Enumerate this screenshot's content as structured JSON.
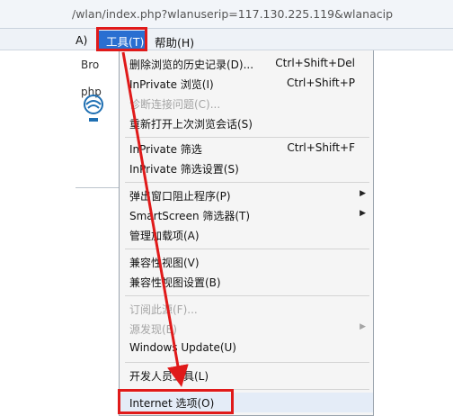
{
  "address_bar": {
    "url": "/wlan/index.php?wlanuserip=117.130.225.119&wlanacip"
  },
  "menubar": {
    "cut_item": "A)",
    "tools": "工具(T)",
    "help": "帮助(H)"
  },
  "page_fragments": [
    "Bro",
    "php"
  ],
  "menu_items": [
    {
      "label": "删除浏览的历史记录(D)...",
      "shortcut": "Ctrl+Shift+Del"
    },
    {
      "label": "InPrivate 浏览(I)",
      "shortcut": "Ctrl+Shift+P"
    },
    {
      "label": "诊断连接问题(C)..."
    },
    {
      "label": "重新打开上次浏览会话(S)"
    },
    {
      "label": "InPrivate 筛选",
      "shortcut": "Ctrl+Shift+F"
    },
    {
      "label": "InPrivate 筛选设置(S)"
    },
    {
      "label": "弹出窗口阻止程序(P)"
    },
    {
      "label": "SmartScreen 筛选器(T)"
    },
    {
      "label": "管理加载项(A)"
    },
    {
      "label": "兼容性视图(V)"
    },
    {
      "label": "兼容性视图设置(B)"
    },
    {
      "label": "订阅此源(F)..."
    },
    {
      "label": "源发现(E)"
    },
    {
      "label": "Windows Update(U)"
    },
    {
      "label": "开发人员工具(L)"
    },
    {
      "label": "Internet 选项(O)"
    }
  ],
  "colors": {
    "highlight": "#2a6fd1",
    "annotation": "#e01a1a"
  }
}
